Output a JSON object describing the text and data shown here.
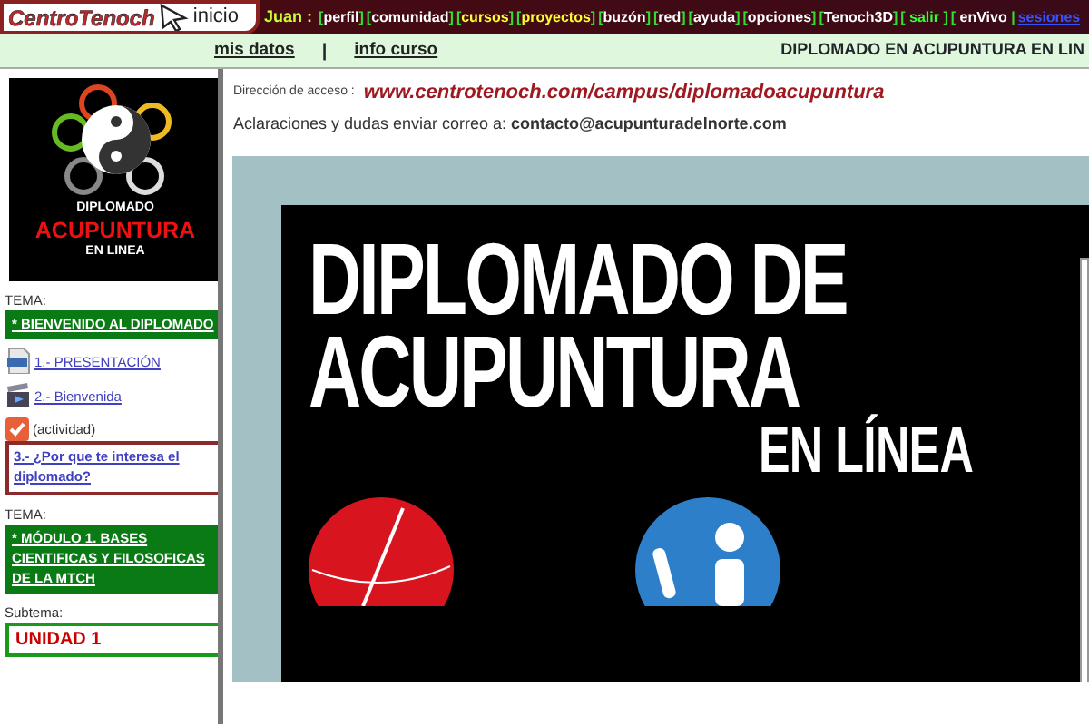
{
  "header": {
    "logo": "CentroTenoch",
    "home": "inicio",
    "user": "Juan :",
    "nav": [
      {
        "left": "[",
        "label": "perfil",
        "right": "]",
        "color": "#ffffff"
      },
      {
        "left": "[",
        "label": "comunidad",
        "right": "]",
        "color": "#ffffff"
      },
      {
        "left": "[",
        "label": "cursos",
        "right": "]",
        "color": "#ffff33"
      },
      {
        "left": "[",
        "label": "proyectos",
        "right": "]",
        "color": "#ffff33"
      },
      {
        "left": "[",
        "label": "buzón",
        "right": "]",
        "color": "#ffffff"
      },
      {
        "left": "[",
        "label": "red",
        "right": "]",
        "color": "#ffffff"
      },
      {
        "left": "[",
        "label": "ayuda",
        "right": "]",
        "color": "#ffffff"
      },
      {
        "left": "[",
        "label": "opciones",
        "right": "]",
        "color": "#ffffff"
      },
      {
        "left": "[",
        "label": "Tenoch3D",
        "right": "]",
        "color": "#ffffff"
      },
      {
        "left": "[ ",
        "label": "salir",
        "right": " ]",
        "color": "#33ff33"
      },
      {
        "left": "[ ",
        "label": "enVivo",
        "right": " |",
        "color": "#ffffff"
      },
      {
        "label": "sesiones",
        "color": "#3355ff"
      }
    ]
  },
  "subnav": {
    "links": [
      "mis datos",
      "info curso"
    ],
    "divider": "|",
    "course_title": "DIPLOMADO EN ACUPUNTURA EN LIN"
  },
  "sidebar": {
    "logo_lines": [
      "DIPLOMADO",
      "ACUPUNTURA",
      "EN LINEA"
    ],
    "items": [
      {
        "kind": "topic",
        "label": "TEMA:",
        "title": "*  BIENVENIDO AL DIPLOMADO"
      },
      {
        "kind": "resource",
        "text": "1.- PRESENTACIÓN"
      },
      {
        "kind": "resource",
        "text": "2.- Bienvenida"
      },
      {
        "kind": "activity",
        "note": "(actividad)",
        "text": "3.- ¿Por que te interesa el diplomado?"
      },
      {
        "kind": "topic",
        "label": "TEMA:",
        "title": "*  MÓDULO 1. BASES CIENTIFICAS Y FILOSOFICAS DE LA MTCH"
      },
      {
        "kind": "subtopic",
        "label": "Subtema:",
        "title": "UNIDAD 1"
      }
    ]
  },
  "content": {
    "address_label": "Dirección de acceso :",
    "address": "www.centrotenoch.com/campus/diplomadoacupuntura",
    "contact": "Aclaraciones y dudas enviar correo a: **contacto@acupunturadelnorte.com**",
    "poster_lines": [
      "DIPLOMADO DE",
      "ACUPUNTURA",
      "EN LÍNEA"
    ]
  }
}
